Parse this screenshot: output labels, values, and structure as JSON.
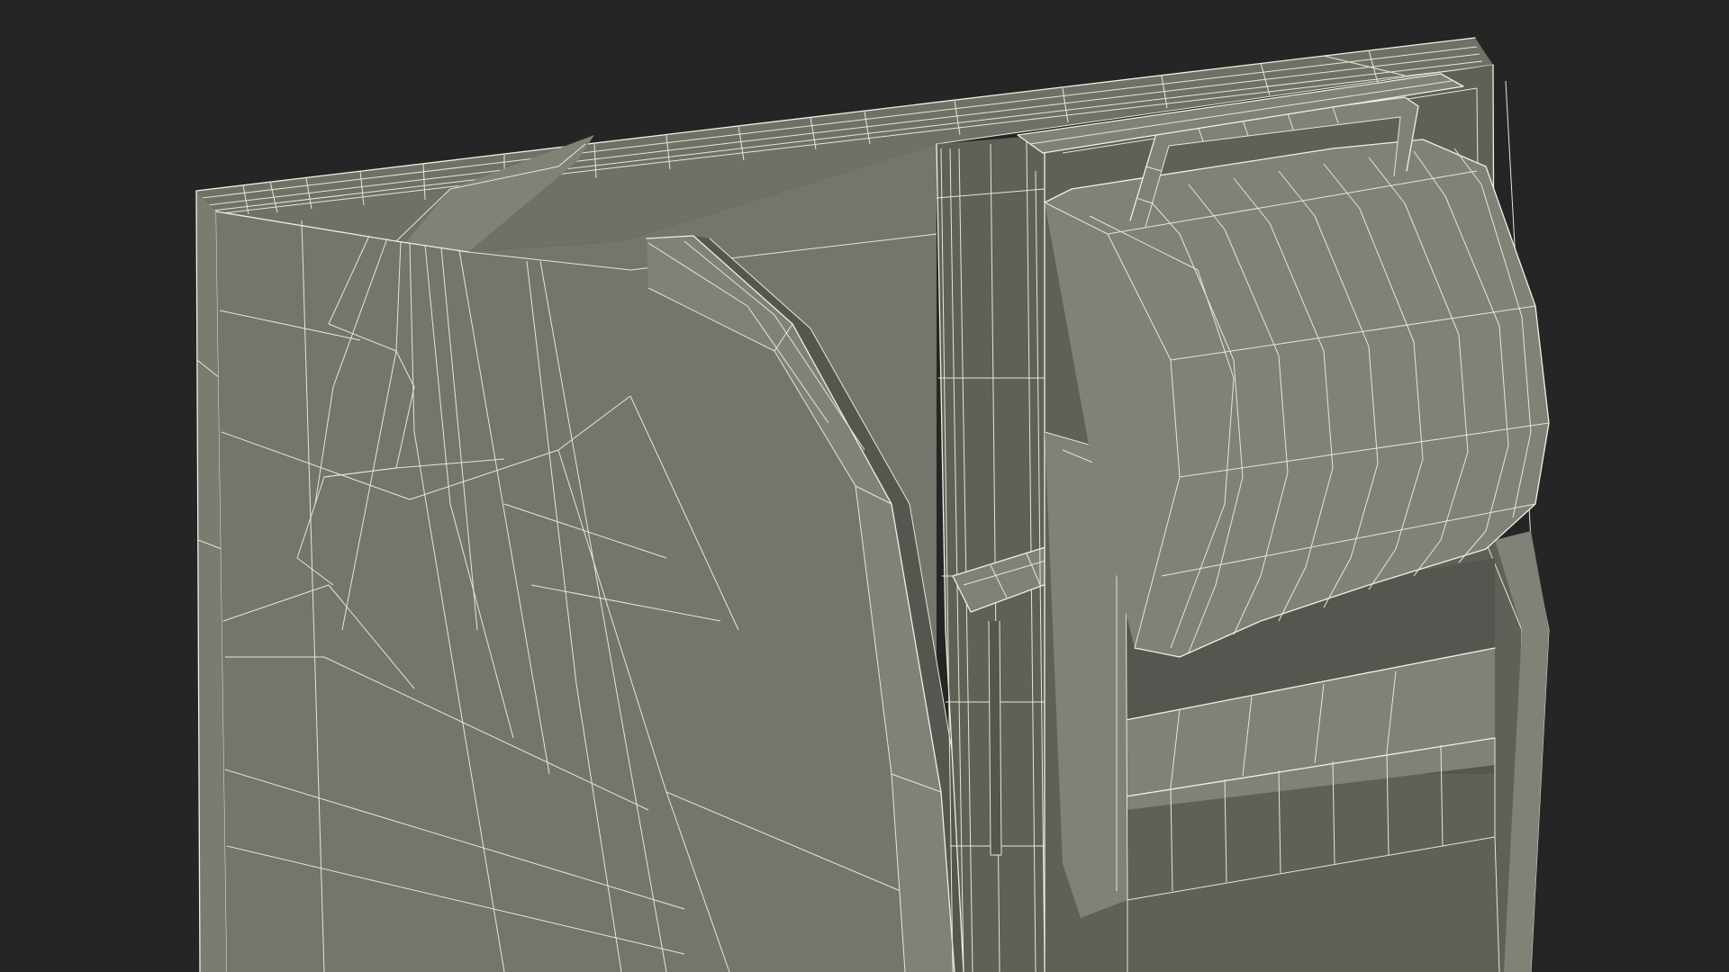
{
  "scene": {
    "background_color": "#252525",
    "mesh_color": "#74756b",
    "wire_color": "#f2f0e2"
  }
}
